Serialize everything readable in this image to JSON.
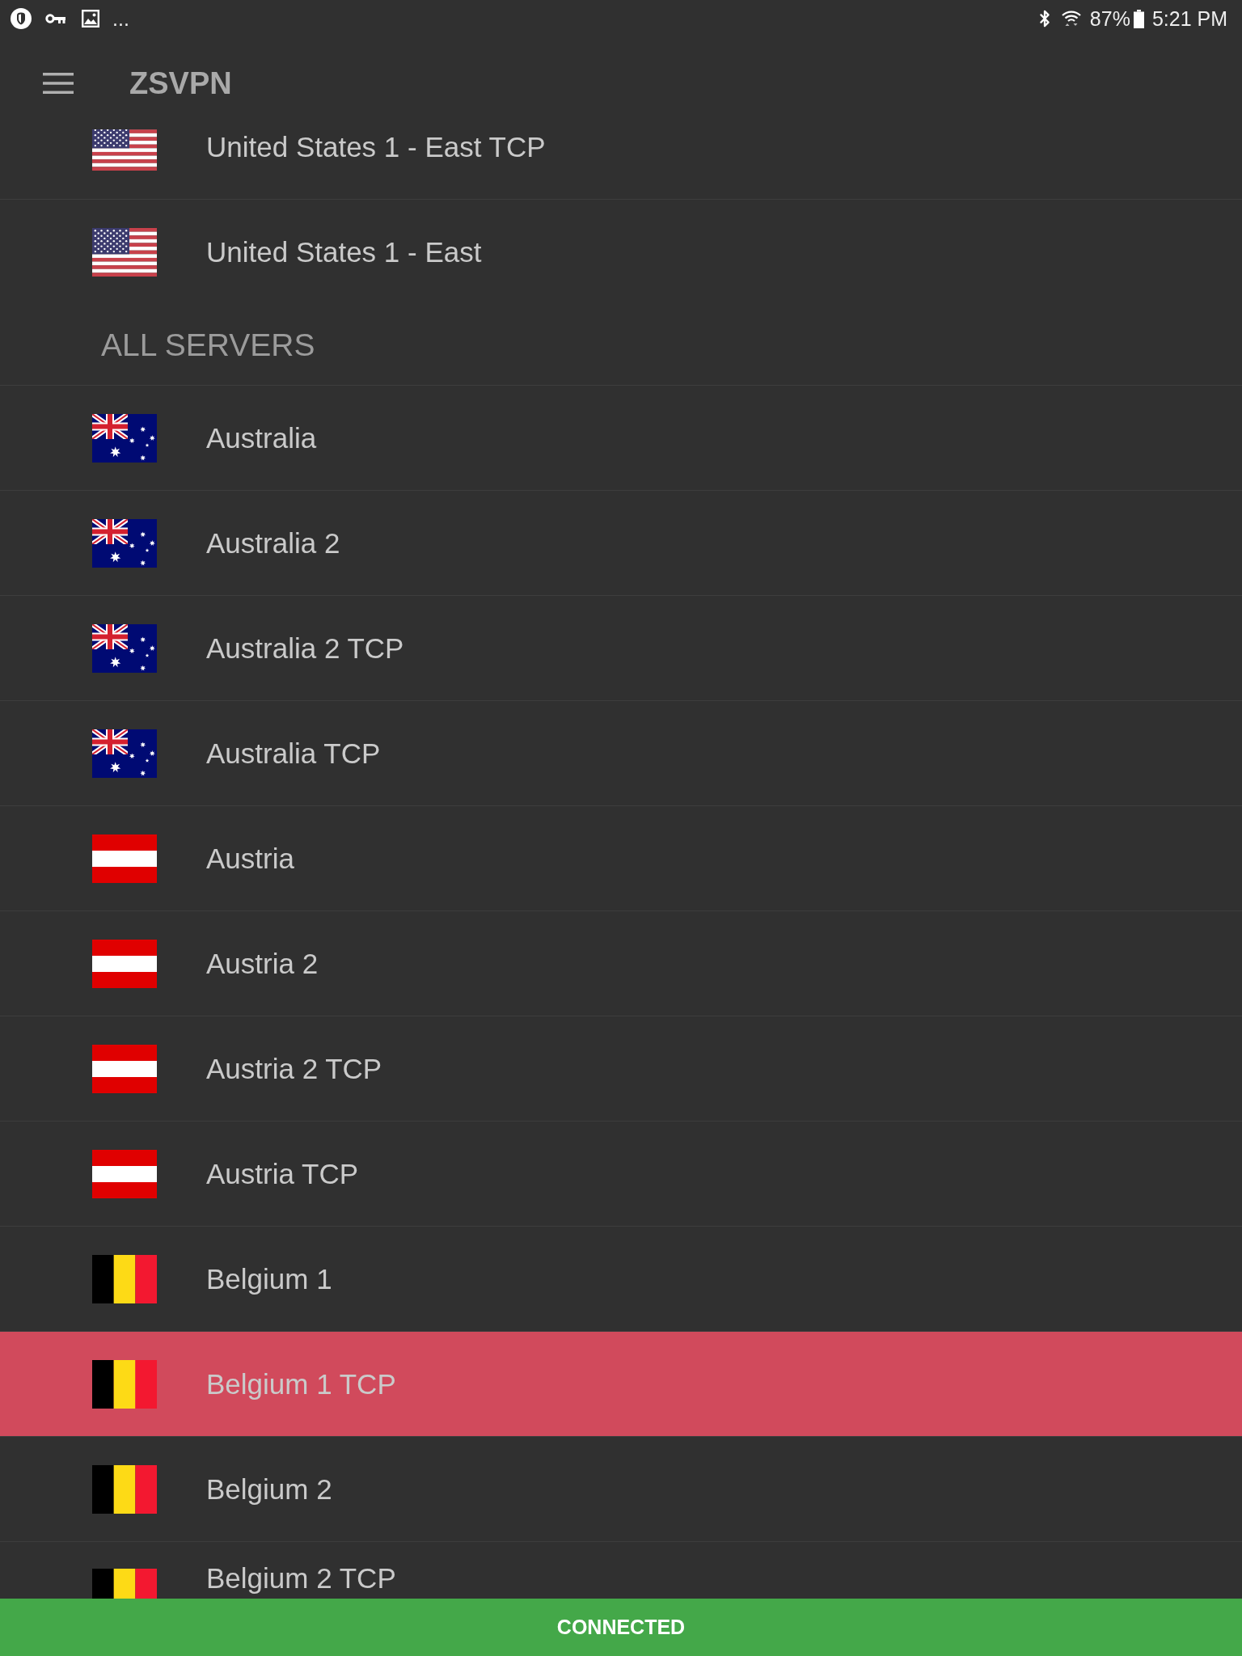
{
  "status_bar": {
    "more_notifications": "...",
    "battery": "87%",
    "time": "5:21 PM"
  },
  "app_bar": {
    "title": "ZSVPN"
  },
  "sections": [
    {
      "items": [
        {
          "name": "United States 1 - East TCP",
          "kind": "usa",
          "selected": false
        },
        {
          "name": "United States 1 - East",
          "kind": "usa",
          "selected": false
        }
      ]
    },
    {
      "header": "ALL SERVERS",
      "items": [
        {
          "name": "Australia",
          "kind": "australia",
          "selected": false
        },
        {
          "name": "Australia 2",
          "kind": "australia",
          "selected": false
        },
        {
          "name": "Australia 2 TCP",
          "kind": "australia",
          "selected": false
        },
        {
          "name": "Australia TCP",
          "kind": "australia",
          "selected": false
        },
        {
          "name": "Austria",
          "kind": "austria",
          "selected": false
        },
        {
          "name": "Austria 2",
          "kind": "austria",
          "selected": false
        },
        {
          "name": "Austria 2 TCP",
          "kind": "austria",
          "selected": false
        },
        {
          "name": "Austria TCP",
          "kind": "austria",
          "selected": false
        },
        {
          "name": "Belgium 1",
          "kind": "belgium",
          "selected": false
        },
        {
          "name": "Belgium 1 TCP",
          "kind": "belgium",
          "selected": true
        },
        {
          "name": "Belgium 2",
          "kind": "belgium",
          "selected": false
        },
        {
          "name": "Belgium 2 TCP",
          "kind": "belgium",
          "selected": false
        }
      ]
    }
  ],
  "connection": {
    "label": "CONNECTED",
    "connected": true
  }
}
